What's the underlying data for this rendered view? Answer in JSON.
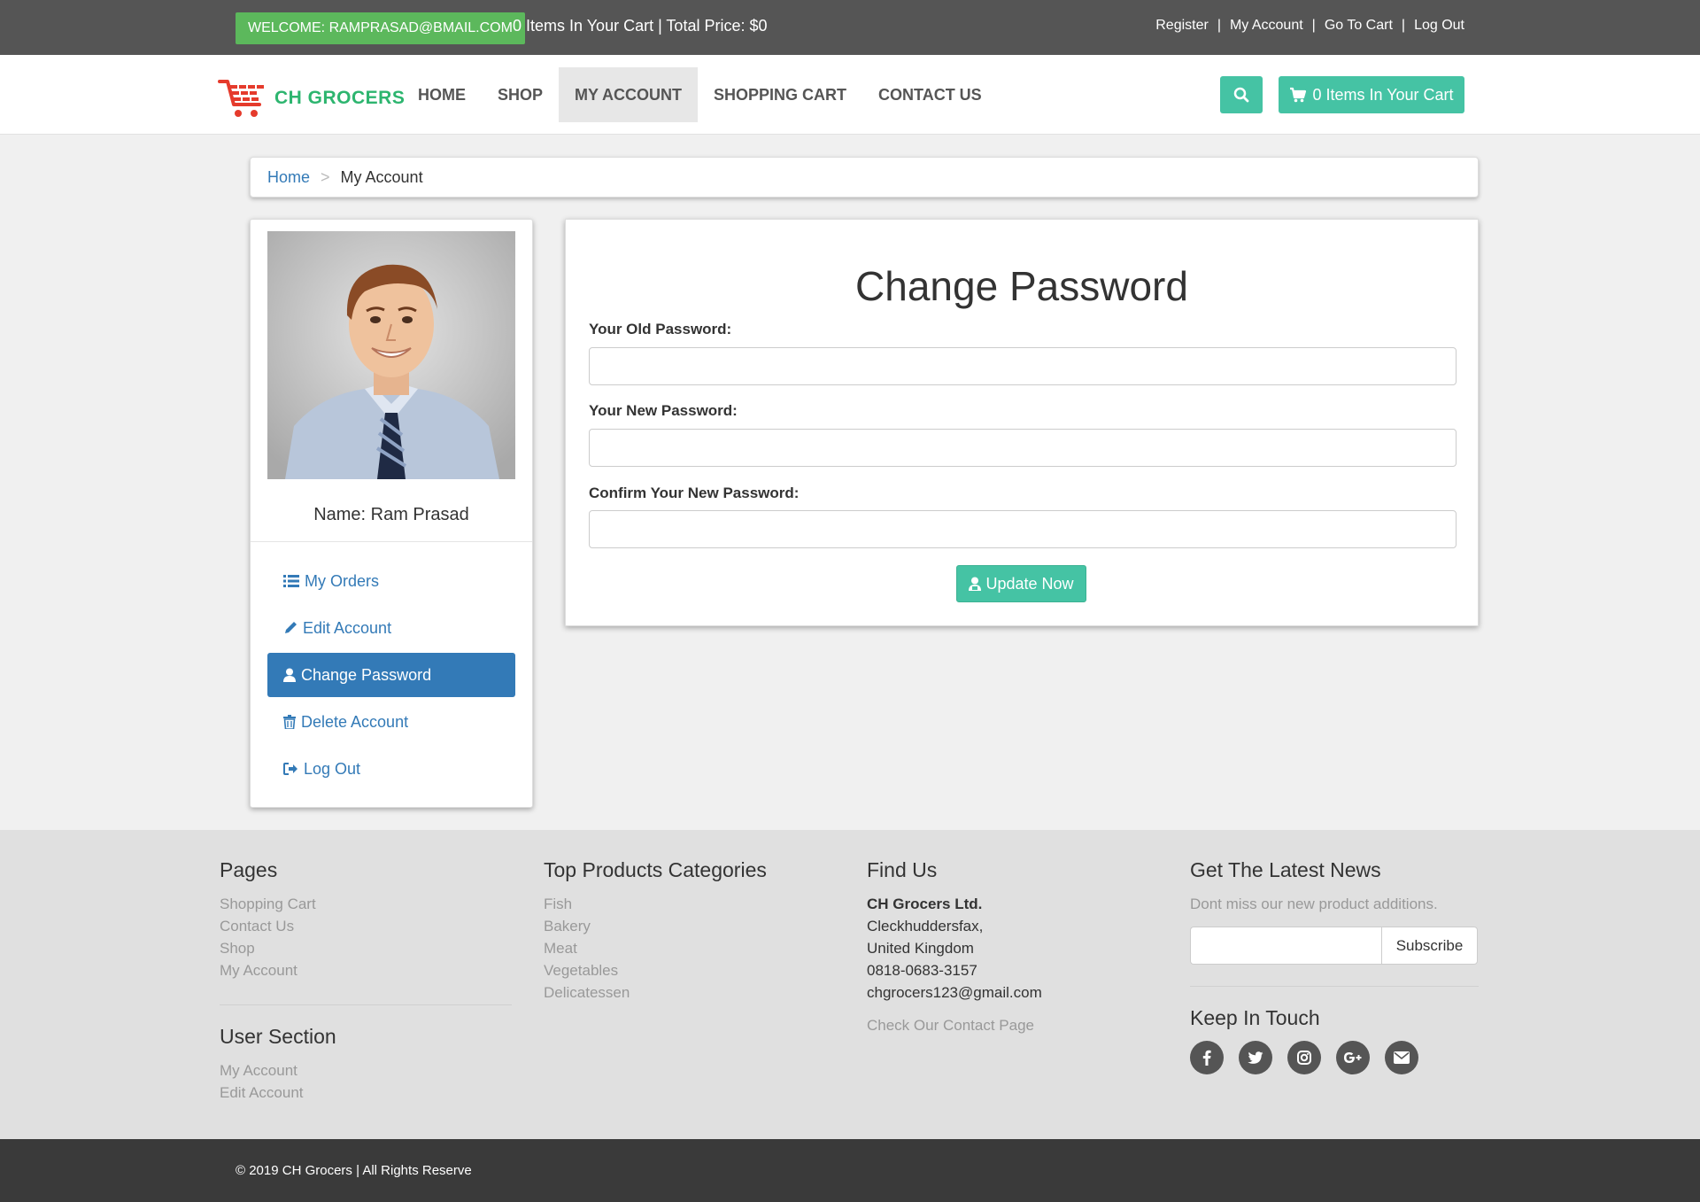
{
  "topbar": {
    "welcome": "WELCOME: RAMPRASAD@BMAIL.COM",
    "cart_info": "0 Items In Your Cart | Total Price: $0",
    "links": [
      "Register",
      "My Account",
      "Go To Cart",
      "Log Out"
    ],
    "separator": "|"
  },
  "navbar": {
    "logo_text": "CH GROCERS",
    "items": [
      "HOME",
      "SHOP",
      "MY ACCOUNT",
      "SHOPPING CART",
      "CONTACT US"
    ],
    "active_item": "MY ACCOUNT",
    "search_icon": "search-icon",
    "cart_button": "0 Items In Your Cart",
    "accent_color": "#45c3a4"
  },
  "breadcrumb": {
    "home": "Home",
    "divider": ">",
    "current": "My Account"
  },
  "profile": {
    "name": "Name: Ram Prasad",
    "menu": [
      {
        "label": "My Orders",
        "icon": "list-icon"
      },
      {
        "label": "Edit Account",
        "icon": "pencil-icon"
      },
      {
        "label": "Change Password",
        "icon": "user-icon",
        "active": true
      },
      {
        "label": "Delete Account",
        "icon": "trash-icon"
      },
      {
        "label": "Log Out",
        "icon": "sign-out-icon"
      }
    ]
  },
  "change_password": {
    "title": "Change Password",
    "old_label": "Your Old Password:",
    "new_label": "Your New Password:",
    "confirm_label": "Confirm Your New Password:",
    "old_value": "",
    "new_value": "",
    "confirm_value": "",
    "button": "Update Now"
  },
  "footer": {
    "pages": {
      "title": "Pages",
      "links": [
        "Shopping Cart",
        "Contact Us",
        "Shop",
        "My Account"
      ]
    },
    "user_section": {
      "title": "User Section",
      "links": [
        "My Account",
        "Edit Account"
      ]
    },
    "categories": {
      "title": "Top Products Categories",
      "links": [
        "Fish",
        "Bakery",
        "Meat",
        "Vegetables",
        "Delicatessen"
      ]
    },
    "find_us": {
      "title": "Find Us",
      "company": "CH Grocers Ltd.",
      "address1": "Cleckhuddersfax,",
      "address2": "United Kingdom",
      "phone": "0818-0683-3157",
      "email": "chgrocers123@gmail.com",
      "contact_link": "Check Our Contact Page"
    },
    "news": {
      "title": "Get The Latest News",
      "text": "Dont miss our new product additions.",
      "email_value": "",
      "subscribe": "Subscribe",
      "keep_title": "Keep In Touch",
      "socials": [
        "facebook-icon",
        "twitter-icon",
        "instagram-icon",
        "google-plus-icon",
        "envelope-icon"
      ]
    },
    "copyright": "© 2019 CH Grocers | All Rights Reserve"
  }
}
